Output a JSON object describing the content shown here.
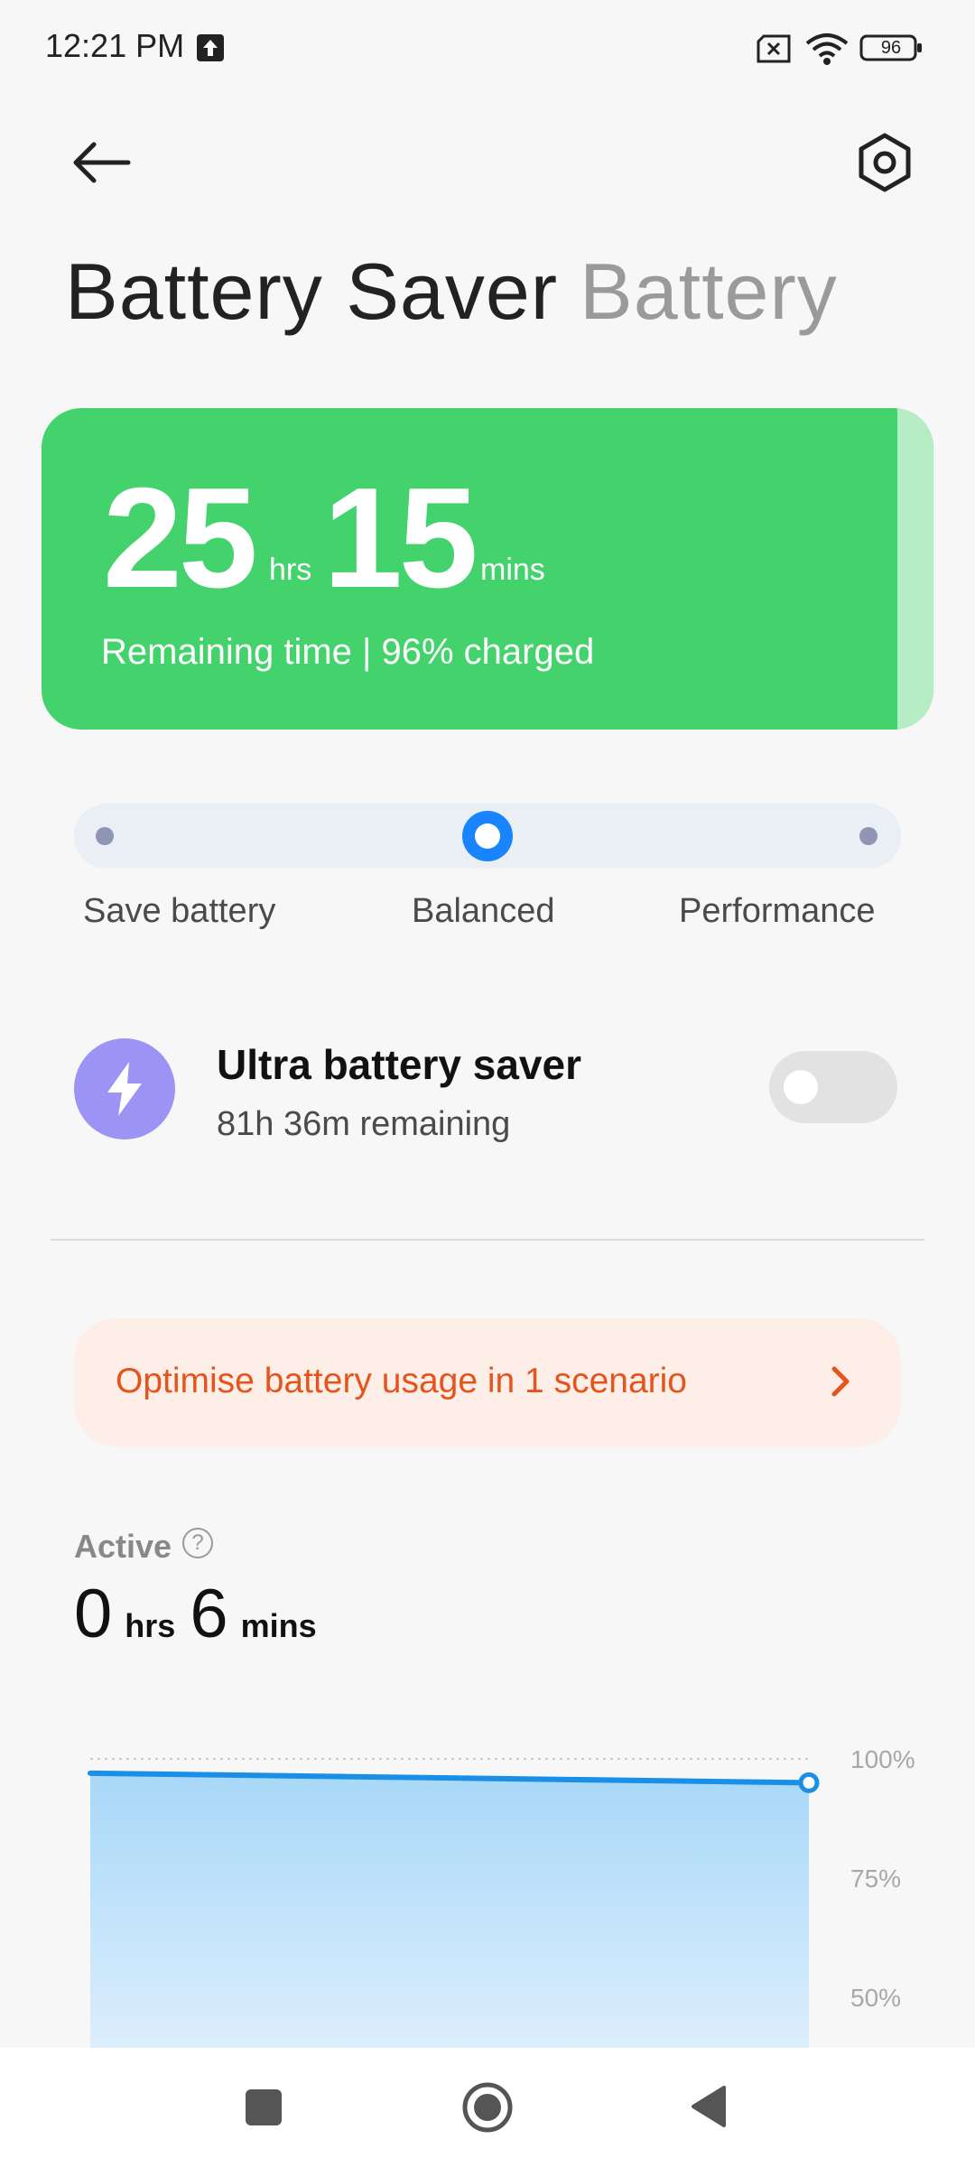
{
  "status_bar": {
    "time": "12:21 PM",
    "battery_level": "96"
  },
  "header": {
    "tabs": [
      {
        "label": "Battery Saver",
        "active": true
      },
      {
        "label": "Battery",
        "active": false
      }
    ]
  },
  "remaining_card": {
    "hours": "25",
    "hours_unit": "hrs",
    "mins": "15",
    "mins_unit": "mins",
    "subtitle": "Remaining time | 96% charged",
    "color": "#43d26b"
  },
  "mode_selector": {
    "options": [
      "Save battery",
      "Balanced",
      "Performance"
    ],
    "selected": "Balanced"
  },
  "ultra_saver": {
    "title": "Ultra battery saver",
    "subtitle": "81h 36m remaining",
    "enabled": false,
    "icon": "lightning-icon"
  },
  "optimise": {
    "label": "Optimise battery usage in 1 scenario",
    "color": "#e4541c"
  },
  "active": {
    "label": "Active",
    "hours": "0",
    "hours_unit": "hrs",
    "mins": "6",
    "mins_unit": "mins"
  },
  "chart_data": {
    "type": "area",
    "x": [
      0,
      1
    ],
    "series": [
      {
        "values": [
          97,
          95
        ]
      }
    ],
    "y_ticks": [
      "100%",
      "75%",
      "50%"
    ],
    "ylim": [
      50,
      100
    ],
    "grid": true,
    "color": "#1a8fe8"
  }
}
